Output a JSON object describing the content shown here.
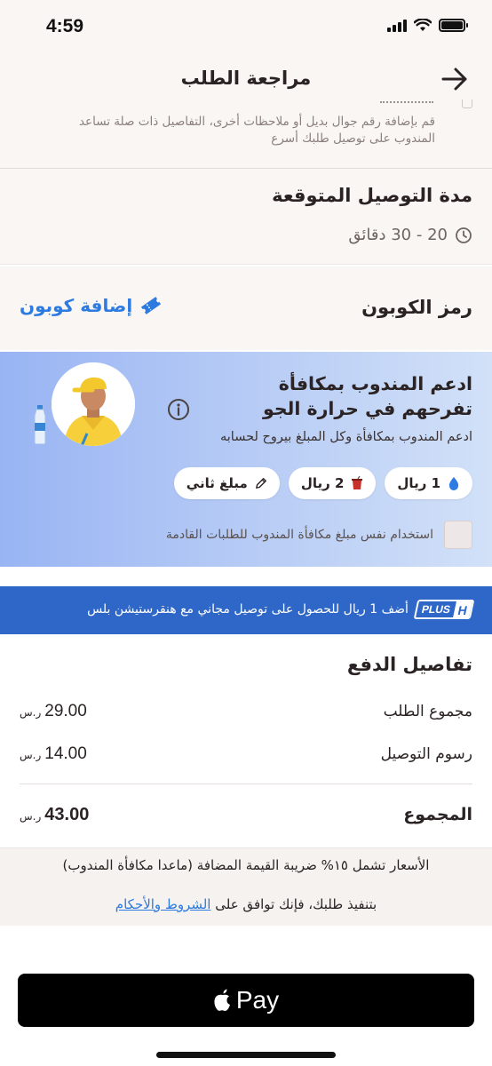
{
  "status_bar": {
    "time": "4:59"
  },
  "header": {
    "title": "مراجعة الطلب",
    "back_icon": "arrow-right-icon"
  },
  "note": {
    "text": "قم بإضافة رقم جوال بديل أو ملاحظات أخرى، التفاصيل ذات صلة تساعد المندوب على توصيل طلبك أسرع"
  },
  "delivery": {
    "title": "مدة التوصيل المتوقعة",
    "time": "20 - 30 دقائق",
    "icon": "clock-icon"
  },
  "coupon": {
    "title": "رمز الكوبون",
    "link": "إضافة كوبون",
    "icon": "ticket-icon"
  },
  "tip": {
    "title": "ادعم المندوب بمكافأة تفرحهم في حرارة الجو",
    "subtitle": "ادعم المندوب بمكافأة وكل المبلغ بيروح لحسابه",
    "options": [
      {
        "label": "1 ريال",
        "icon": "water-drop-icon"
      },
      {
        "label": "2 ريال",
        "icon": "drink-cup-icon"
      },
      {
        "label": "مبلغ ثاني",
        "icon": "pencil-icon"
      }
    ],
    "remember_label": "استخدام نفس مبلغ مكافأة المندوب للطلبات القادمة",
    "colors": {
      "gradient_start": "#99b4f4",
      "gradient_end": "#d2e1f8"
    }
  },
  "hplus": {
    "badge_h": "H",
    "badge_plus": "PLUS",
    "text": "أضف 1 ريال للحصول على توصيل مجاني مع هنقرستيشن بلس",
    "color": "#2f67c9"
  },
  "payment": {
    "title": "تفاصيل الدفع",
    "currency": "ر.س",
    "rows": [
      {
        "label": "مجموع الطلب",
        "value": "29.00"
      },
      {
        "label": "رسوم التوصيل",
        "value": "14.00"
      }
    ],
    "total": {
      "label": "المجموع",
      "value": "43.00"
    }
  },
  "vat": {
    "text": "الأسعار تشمل ١٥% ضريبة القيمة المضافة (ماعدا مكافأة المندوب)",
    "terms_prefix": "بتنفيذ طلبك، فإنك توافق على",
    "terms_link": "الشروط والأحكام"
  },
  "apple_pay": {
    "label": "Pay"
  },
  "accent_color": "#2d7ae0"
}
